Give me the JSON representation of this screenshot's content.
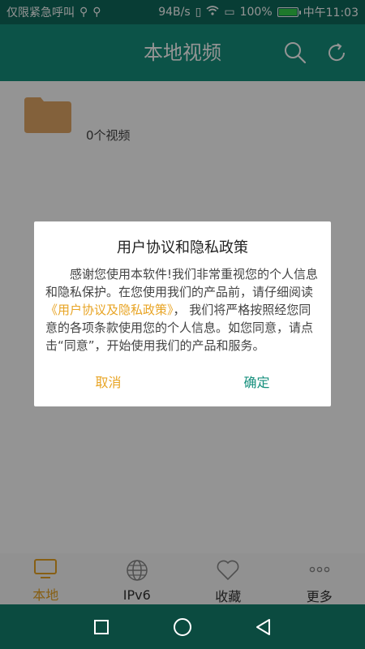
{
  "status_bar": {
    "carrier": "仅限紧急呼叫",
    "speed": "94B/s",
    "battery": "100%",
    "time": "中午11:03"
  },
  "app_bar": {
    "title": "本地视频",
    "search_icon": "search-icon",
    "refresh_icon": "refresh-icon"
  },
  "content": {
    "folder_count": "0个视频",
    "folder_color": "#e2a766"
  },
  "dialog": {
    "title": "用户协议和隐私政策",
    "body_pre": "感谢您使用本软件!我们非常重视您的个人信息和隐私保护。在您使用我们的产品前，请仔细阅读",
    "body_link": "《用户协议及隐私政策》",
    "body_post": "， 我们将严格按照经您同意的各项条款使用您的个人信息。如您同意，请点击“同意”，开始使用我们的产品和服务。",
    "cancel_label": "取消",
    "ok_label": "确定"
  },
  "bottom_nav": {
    "items": [
      {
        "label": "本地",
        "icon": "tv-icon",
        "active": true
      },
      {
        "label": "IPv6",
        "icon": "globe-icon",
        "active": false
      },
      {
        "label": "收藏",
        "icon": "heart-icon",
        "active": false
      },
      {
        "label": "更多",
        "icon": "more-icon",
        "active": false
      }
    ]
  },
  "colors": {
    "primary": "#158f7c",
    "accent": "#e8a424"
  }
}
